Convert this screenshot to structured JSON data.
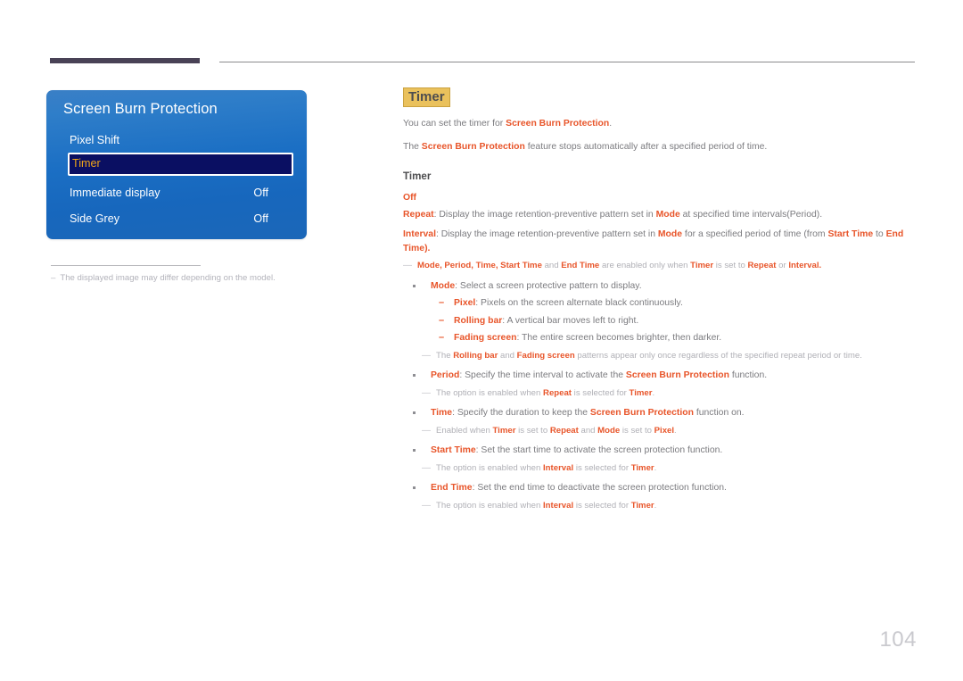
{
  "page": {
    "number": "104"
  },
  "osd": {
    "title": "Screen Burn Protection",
    "rows": [
      {
        "label": "Pixel Shift",
        "value": ""
      },
      {
        "label": "Timer",
        "value": ""
      },
      {
        "label": "Immediate display",
        "value": "Off"
      },
      {
        "label": "Side Grey",
        "value": "Off"
      }
    ],
    "selected_row": "Timer",
    "footnote": {
      "dash": "–",
      "text": "The displayed image may differ depending on the model."
    }
  },
  "content": {
    "heading": "Timer",
    "intro_1": {
      "a": "You can set the timer for ",
      "b": "Screen Burn Protection",
      "c": "."
    },
    "intro_2": {
      "a": "The ",
      "b": "Screen Burn Protection",
      "c": " feature stops automatically after a specified period of time."
    },
    "subheading": "Timer",
    "options": {
      "off": "Off",
      "repeat": {
        "name": "Repeat",
        "t1": ": Display the image retention-preventive pattern set in ",
        "mode": "Mode",
        "t2": " at specified time intervals(Period)."
      },
      "interval": {
        "name": "Interval",
        "t1": ": Display the image retention-preventive pattern set in ",
        "mode": "Mode",
        "t2": " for a specified period of time (from ",
        "start_time": "Start Time",
        "t3": " to ",
        "end_time": "End Time",
        "t4": ")."
      },
      "enabled_note": {
        "mode": "Mode",
        "c1": ", ",
        "period": "Period",
        "c2": ", ",
        "time": "Time",
        "c3": ", ",
        "start_time": "Start Time",
        "and": " and ",
        "end_time": "End Time",
        "t1": " are enabled only when ",
        "timer": "Timer",
        "t2": " is set to ",
        "repeat": "Repeat",
        "t3": " or ",
        "interval": "Interval",
        "t4": "."
      }
    },
    "bullets": {
      "mode": {
        "name": "Mode",
        "text": ": Select a screen protective pattern to display.",
        "sub": [
          {
            "name": "Pixel",
            "text": ": Pixels on the screen alternate black continuously."
          },
          {
            "name": "Rolling bar",
            "text": ": A vertical bar moves left to right."
          },
          {
            "name": "Fading screen",
            "text": ": The entire screen becomes brighter, then darker."
          }
        ],
        "note": {
          "t1": "The ",
          "rolling_bar": "Rolling bar",
          "t2": " and ",
          "fading_screen": "Fading screen",
          "t3": " patterns appear only once regardless of the specified repeat period or time."
        }
      },
      "period": {
        "name": "Period",
        "t1": ": Specify the time interval to activate the ",
        "sbp": "Screen Burn Protection",
        "t2": " function.",
        "note": {
          "t1": "The option is enabled when ",
          "repeat": "Repeat",
          "t2": " is selected for ",
          "timer": "Timer",
          "t3": "."
        }
      },
      "time": {
        "name": "Time",
        "t1": ": Specify the duration to keep the ",
        "sbp": "Screen Burn Protection",
        "t2": " function on.",
        "note": {
          "t1": "Enabled when ",
          "timer": "Timer",
          "t2": " is set to ",
          "repeat": "Repeat",
          "t3": " and ",
          "mode": "Mode",
          "t4": " is set to ",
          "pixel": "Pixel",
          "t5": "."
        }
      },
      "start_time": {
        "name": "Start Time",
        "t1": ": Set the start time to activate the screen protection function.",
        "note": {
          "t1": "The option is enabled when ",
          "interval": "Interval",
          "t2": " is selected for ",
          "timer": "Timer",
          "t3": "."
        }
      },
      "end_time": {
        "name": "End Time",
        "t1": ": Set the end time to deactivate the screen protection function.",
        "note": {
          "t1": "The option is enabled when ",
          "interval": "Interval",
          "t2": " is selected for ",
          "timer": "Timer",
          "t3": "."
        }
      }
    }
  },
  "colors": {
    "accent_orange": "#e8552a",
    "heading_highlight": "#eac15c",
    "osd_blue": "#1b6fc4",
    "osd_selected": "#0a0f62",
    "osd_selected_text": "#f0a519",
    "header_bar": "#494256"
  }
}
